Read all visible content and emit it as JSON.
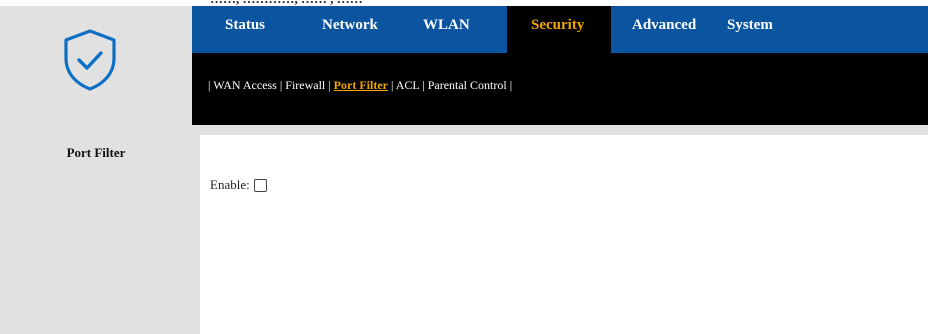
{
  "top_fragment": "……, …………, …… , ……",
  "nav": {
    "items": [
      {
        "label": "Status",
        "active": false
      },
      {
        "label": "Network",
        "active": false
      },
      {
        "label": "WLAN",
        "active": false
      },
      {
        "label": "Security",
        "active": true
      },
      {
        "label": "Advanced",
        "active": false
      },
      {
        "label": "System",
        "active": false
      }
    ]
  },
  "subnav": {
    "items": [
      {
        "label": "WAN Access",
        "active": false
      },
      {
        "label": "Firewall",
        "active": false
      },
      {
        "label": "Port Filter",
        "active": true
      },
      {
        "label": "ACL",
        "active": false
      },
      {
        "label": "Parental Control",
        "active": false
      }
    ],
    "separator": "|"
  },
  "sidebar": {
    "items": [
      {
        "label": "Port Filter"
      }
    ]
  },
  "content": {
    "enable_label": "Enable:",
    "enable_checked": false
  },
  "logo": {
    "icon": "shield-check-icon",
    "color": "#0b6fc6"
  },
  "colors": {
    "nav_bg": "#0b55a0",
    "active_text": "#f0a500",
    "panel_bg": "#e1e1e1"
  }
}
